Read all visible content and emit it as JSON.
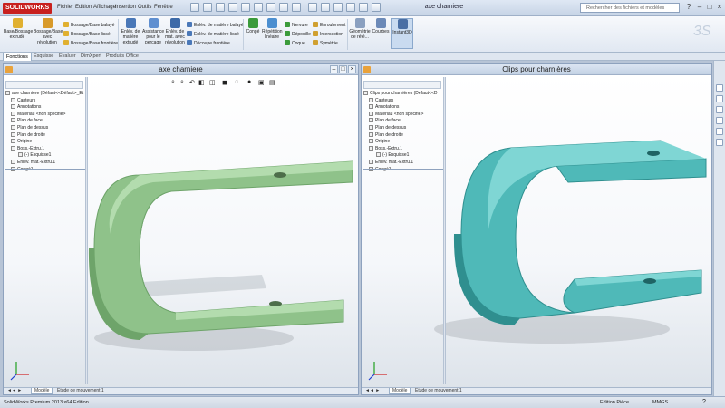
{
  "app": {
    "logo": "SOLIDWORKS",
    "title": "axe charniere"
  },
  "menu": [
    "Fichier",
    "Edition",
    "Affichage",
    "Insertion",
    "Outils",
    "Fenêtre"
  ],
  "search": {
    "placeholder": "Rechercher des fichiers et modèles"
  },
  "ribbon": {
    "big": [
      {
        "label": "Base/Bossage extrudé",
        "color": "#e0b030"
      },
      {
        "label": "Bossage/Base avec révolution",
        "color": "#d89a2a"
      },
      {
        "label": "Enlèv. de matière extrudé",
        "color": "#4a78b8"
      },
      {
        "label": "Assistance pour le perçage",
        "color": "#5f8fd0"
      },
      {
        "label": "Enlèv. de mat. avec révolution",
        "color": "#3d6aa8"
      }
    ],
    "boss_small": [
      "Bossage/Base balayé",
      "Bossage/Base lissé",
      "Bossage/Base frontière"
    ],
    "cut_small": [
      "Enlèv. de matière balayé",
      "Enlèv. de matière lissé",
      "Découpe frontière"
    ],
    "mid_big": [
      {
        "label": "Congé",
        "color": "#3b9b3b"
      },
      {
        "label": "Répétition linéaire",
        "color": "#4c8fd0"
      }
    ],
    "feat_small": [
      "Nervure",
      "Dépouille",
      "Coque"
    ],
    "feat2_small": [
      "Enroulement",
      "Intersection",
      "Symétrie"
    ],
    "end_big": [
      {
        "label": "Géométrie de réfé...",
        "color": "#8aa0c0"
      },
      {
        "label": "Courbes",
        "color": "#6c8ab8"
      },
      {
        "label": "Instant3D",
        "color": "#4a6fa5"
      }
    ]
  },
  "tabs": [
    "Fonctions",
    "Esquisse",
    "Evaluer",
    "DimXpert",
    "Produits Office"
  ],
  "doc1": {
    "title": "axe charniere",
    "tree": [
      "axe charniere (Défaut<<Défaut>_Et",
      "Capteurs",
      "Annotations",
      "Matériau <non spécifié>",
      "Plan de face",
      "Plan de dessus",
      "Plan de droite",
      "Origine",
      "Boss.-Extru.1",
      "(-) Esquisse1",
      "Enlèv. mat.-Extru.1",
      "Congé1"
    ],
    "color": "#8fc28a",
    "color_dark": "#6ea46a",
    "color_light": "#b3dcae"
  },
  "doc2": {
    "title": "Clips pour charnières",
    "tree": [
      "Clips pour charnières (Défaut<<D",
      "Capteurs",
      "Annotations",
      "Matériau <non spécifié>",
      "Plan de face",
      "Plan de dessus",
      "Plan de droite",
      "Origine",
      "Boss.-Extru.1",
      "(-) Esquisse1",
      "Enlèv. mat.-Extru.1",
      "Congé1"
    ],
    "color": "#4fb9b8",
    "color_dark": "#2f8f8f",
    "color_light": "#7fd6d4"
  },
  "bottom_tabs": [
    "Modèle",
    "Etude de mouvement 1"
  ],
  "status": {
    "left": "SolidWorks Premium 2013 x64 Edition",
    "mode": "Edition Pièce",
    "units": "MMGS"
  }
}
